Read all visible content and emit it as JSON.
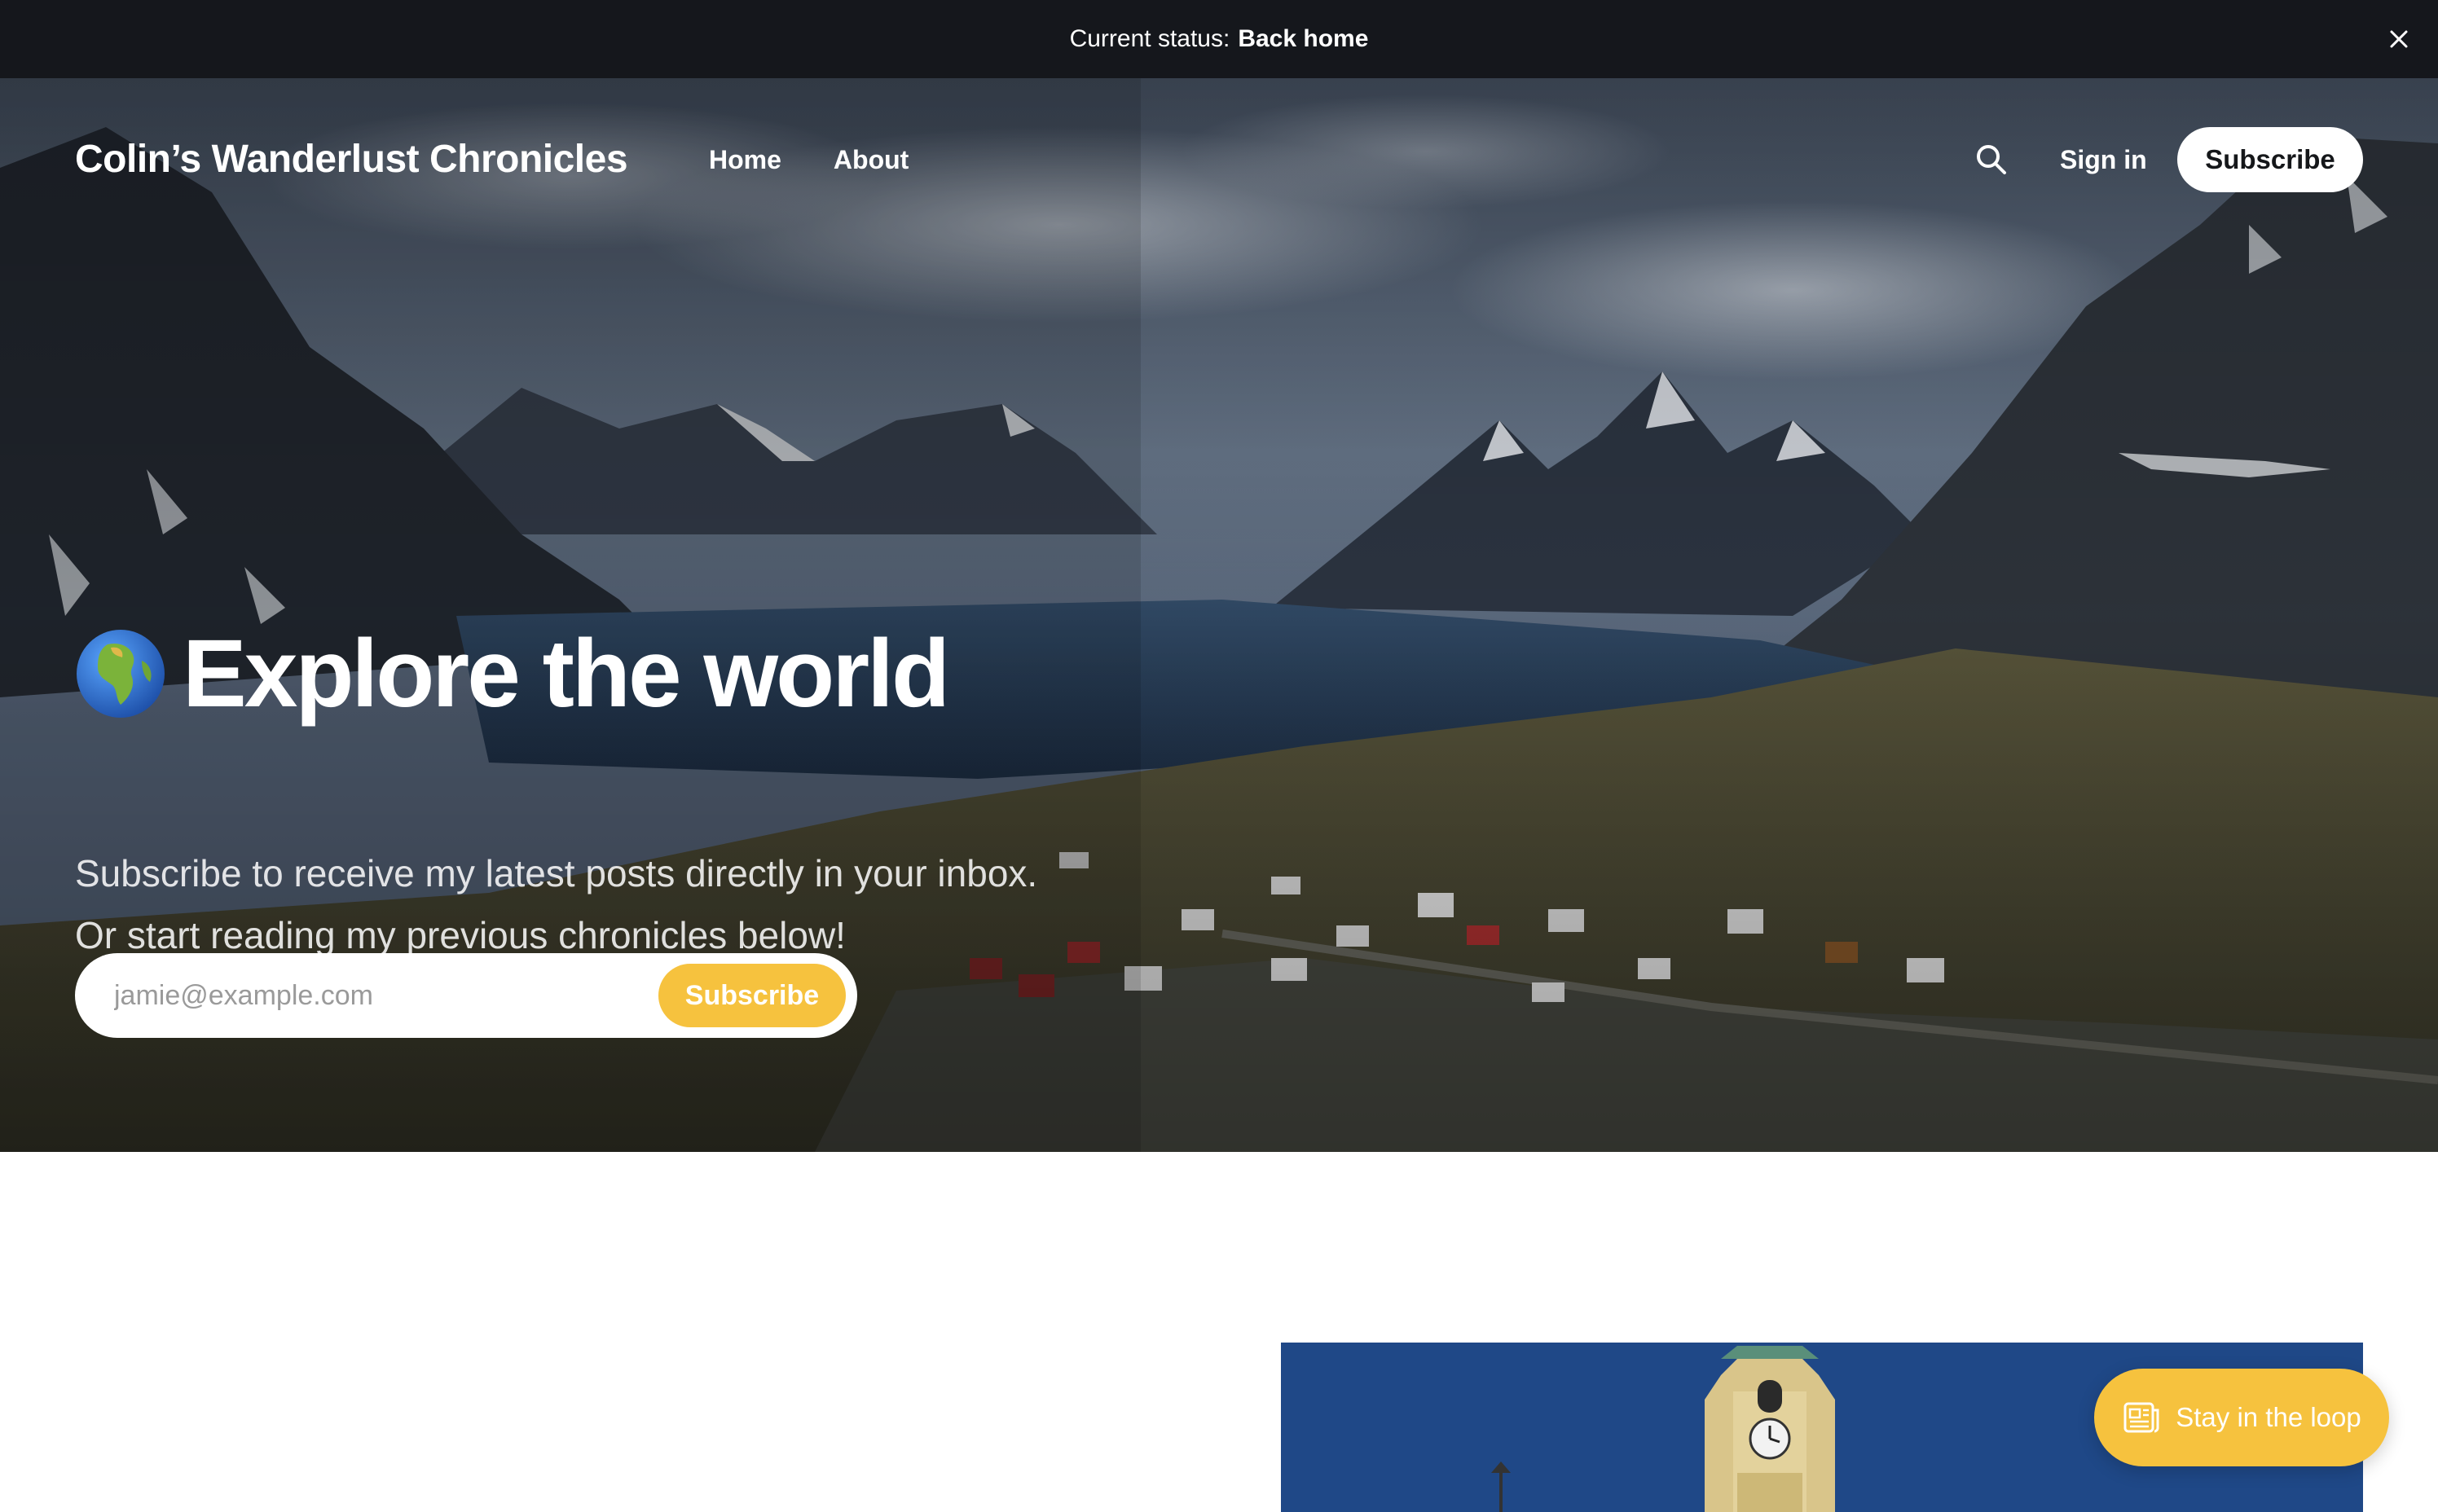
{
  "announcement": {
    "label": "Current status:",
    "value": "Back home",
    "close_icon": "close-icon"
  },
  "site": {
    "title": "Colin’s Wanderlust Chronicles"
  },
  "nav": {
    "items": [
      {
        "label": "Home"
      },
      {
        "label": "About"
      }
    ]
  },
  "header_actions": {
    "search_icon": "search-icon",
    "sign_in": "Sign in",
    "subscribe": "Subscribe"
  },
  "hero": {
    "emoji_icon": "globe-icon",
    "title": "Explore the world",
    "subtitle_line1": "Subscribe to receive my latest posts directly in your inbox.",
    "subtitle_line2": "Or start reading my previous chronicles below!",
    "email_placeholder": "jamie@example.com",
    "subscribe_button": "Subscribe"
  },
  "portal": {
    "icon": "newspaper-icon",
    "label": "Stay in the loop"
  },
  "colors": {
    "announcement_bg": "#15171c",
    "accent": "#f6c23e",
    "text_on_dark": "#ffffff"
  }
}
